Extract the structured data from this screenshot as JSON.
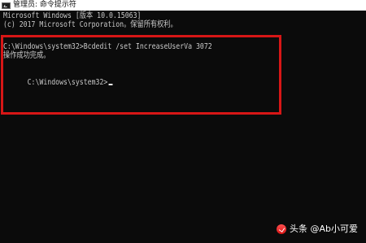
{
  "window": {
    "title": "管理员: 命令提示符"
  },
  "console": {
    "lines": [
      "Microsoft Windows [版本 10.0.15063]",
      "(c) 2017 Microsoft Corporation。保留所有权利。",
      "",
      "C:\\Windows\\system32>Bcdedit /set IncreaseUserVa 3072",
      "操作成功完成。",
      "",
      "C:\\Windows\\system32>"
    ]
  },
  "icons": {
    "title_icon": "cmd-icon",
    "watermark_icon": "toutiao-icon"
  },
  "watermark": {
    "text": "头条 @Ab小可爱"
  },
  "colors": {
    "console_background": "#0b0b0b",
    "console_text": "#c8c8c8",
    "highlight_border": "#d71616",
    "titlebar_background": "#ffffff"
  }
}
